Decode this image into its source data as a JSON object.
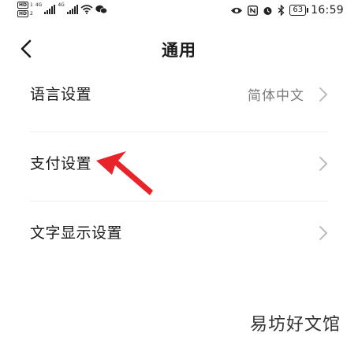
{
  "status_bar": {
    "sim1_badge": "HD",
    "sim1_num": "1",
    "sim2_badge": "HD",
    "sim2_num": "2",
    "net1": "4G",
    "net2": "4G",
    "battery": "63",
    "time": "16:59",
    "icons": [
      "signal-icon",
      "signal-icon",
      "wifi-icon",
      "wechat-icon",
      "eye-icon",
      "nfc-icon",
      "alarm-icon",
      "bluetooth-icon"
    ]
  },
  "header": {
    "title": "通用",
    "back_icon": "chevron-left-icon"
  },
  "settings": {
    "items": [
      {
        "label": "语言设置",
        "value": "简体中文"
      },
      {
        "label": "支付设置",
        "value": ""
      },
      {
        "label": "文字显示设置",
        "value": ""
      }
    ]
  },
  "annotation": {
    "color": "#e8232a",
    "icon": "red-arrow-icon"
  },
  "watermark": {
    "text": "易坊好文馆"
  }
}
